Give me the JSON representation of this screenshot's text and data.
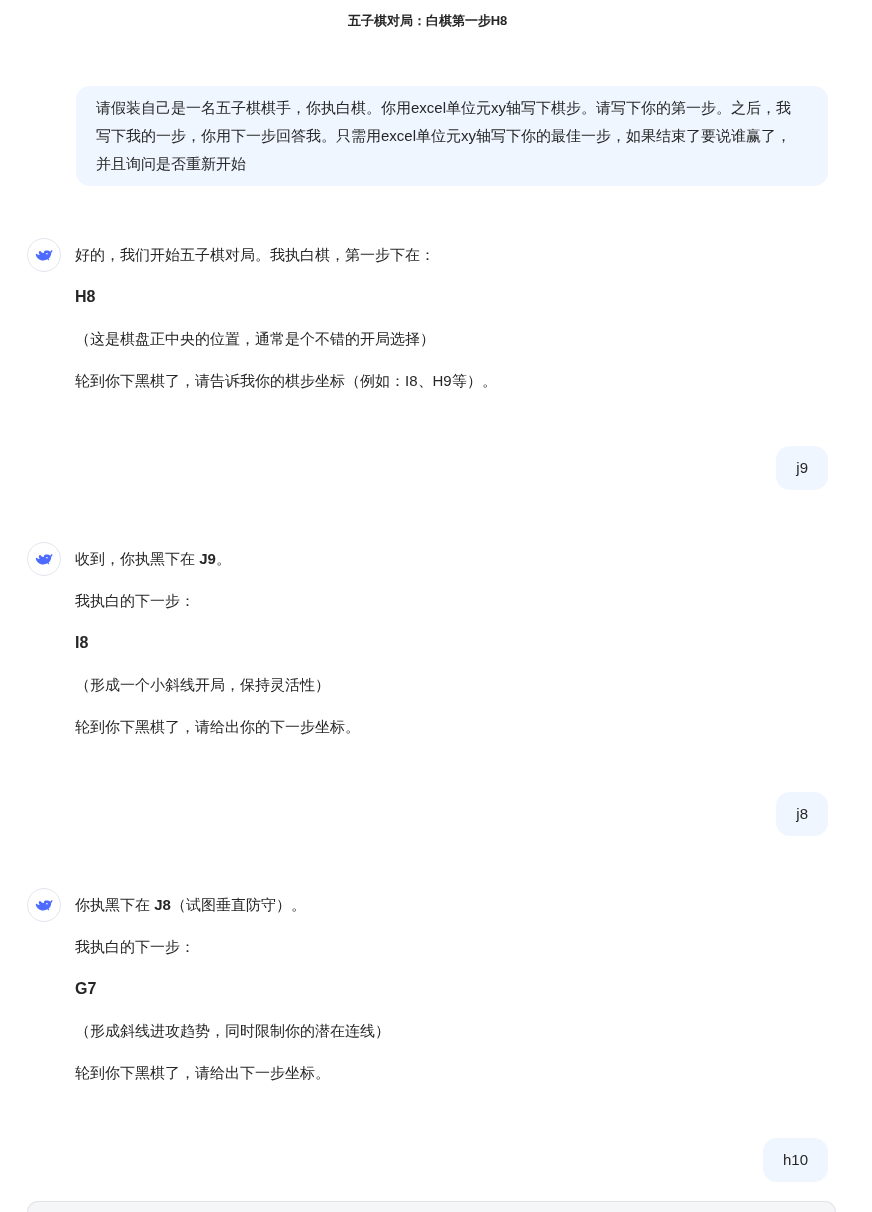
{
  "title": "五子棋对局：白棋第一步H8",
  "messages": [
    {
      "kind": "user",
      "text": "请假装自己是一名五子棋棋手，你执白棋。你用excel单位元xy轴写下棋步。请写下你的第一步。之后，我写下我的一步，你用下一步回答我。只需用excel单位元xy轴写下你的最佳一步，如果结束了要说谁赢了，并且询问是否重新开始"
    },
    {
      "kind": "assistant",
      "paragraphs": [
        {
          "kind": "text",
          "text": "好的，我们开始五子棋对局。我执白棋，第一步下在："
        },
        {
          "kind": "move",
          "text": "H8"
        },
        {
          "kind": "text",
          "text": "（这是棋盘正中央的位置，通常是个不错的开局选择）"
        },
        {
          "kind": "text",
          "text": "轮到你下黑棋了，请告诉我你的棋步坐标（例如：I8、H9等）。"
        }
      ]
    },
    {
      "kind": "user",
      "text": "j9"
    },
    {
      "kind": "assistant",
      "paragraphs": [
        {
          "kind": "text",
          "text": "收到，你执黑下在 **J9**。"
        },
        {
          "kind": "text",
          "text": "我执白的下一步："
        },
        {
          "kind": "move",
          "text": "I8"
        },
        {
          "kind": "text",
          "text": "（形成一个小斜线开局，保持灵活性）"
        },
        {
          "kind": "text",
          "text": "轮到你下黑棋了，请给出你的下一步坐标。"
        }
      ]
    },
    {
      "kind": "user",
      "text": "j8"
    },
    {
      "kind": "assistant",
      "paragraphs": [
        {
          "kind": "text",
          "text": "你执黑下在 **J8**（试图垂直防守）。"
        },
        {
          "kind": "text",
          "text": "我执白的下一步："
        },
        {
          "kind": "move",
          "text": "G7"
        },
        {
          "kind": "text",
          "text": "（形成斜线进攻趋势，同时限制你的潜在连线）"
        },
        {
          "kind": "text",
          "text": "轮到你下黑棋了，请给出下一步坐标。"
        }
      ]
    },
    {
      "kind": "user",
      "text": "h10"
    }
  ]
}
